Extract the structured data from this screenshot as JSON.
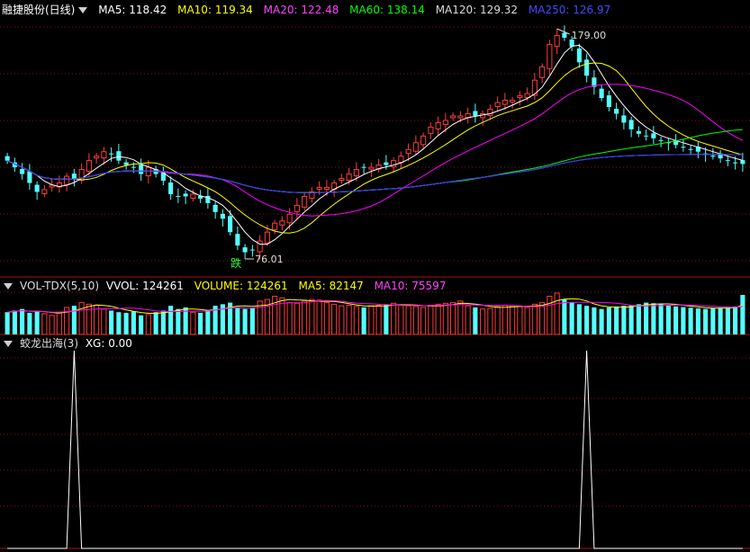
{
  "colors": {
    "bg": "#000000",
    "up": "#ff3c3c",
    "down": "#54ffff",
    "grid": "#8a1010",
    "ma5": "#ffffff",
    "ma10": "#ffff00",
    "ma20": "#ff00ff",
    "ma60": "#00ff00",
    "ma120": "#d0d0d0",
    "ma250": "#3030ff",
    "xg": "#ffffff"
  },
  "price_panel": {
    "stock_name": "融捷股份(日线)",
    "ma": [
      {
        "label": "MA5:",
        "value": "118.42"
      },
      {
        "label": "MA10:",
        "value": "119.34"
      },
      {
        "label": "MA20:",
        "value": "122.48"
      },
      {
        "label": "MA60:",
        "value": "138.14"
      },
      {
        "label": "MA120:",
        "value": "129.32"
      },
      {
        "label": "MA250:",
        "value": "126.97"
      }
    ],
    "high_label": "179.00",
    "low_label": "76.01",
    "signal_tag": "跌"
  },
  "volume_panel": {
    "title": "VOL-TDX(5,10)",
    "items": [
      {
        "label": "VVOL:",
        "value": "124261"
      },
      {
        "label": "VOLUME:",
        "value": "124261"
      },
      {
        "label": "MA5:",
        "value": "82147"
      },
      {
        "label": "MA10:",
        "value": "75597"
      }
    ]
  },
  "xg_panel": {
    "title": "蛟龙出海(3)",
    "items": [
      {
        "label": "XG:",
        "value": "0.00"
      }
    ]
  },
  "chart_data": [
    {
      "type": "candlestick",
      "title": "融捷股份(日线)",
      "ylim": [
        76.01,
        179.0
      ],
      "close": [
        120,
        117,
        114,
        110,
        106,
        107,
        109,
        110,
        113,
        112,
        116,
        120,
        122,
        124,
        123,
        120,
        118,
        117,
        114,
        117,
        114,
        111,
        105,
        104,
        104,
        105,
        103,
        101,
        97,
        94,
        88,
        82,
        79,
        80,
        84,
        88,
        92,
        93,
        96,
        100,
        104,
        106,
        108,
        108,
        110,
        112,
        114,
        116,
        117,
        117,
        118,
        118,
        120,
        122,
        125,
        128,
        131,
        135,
        137,
        138,
        140,
        140,
        141,
        140,
        141,
        143,
        146,
        147,
        147,
        149,
        150,
        156,
        162,
        172,
        176,
        175,
        171,
        164,
        158,
        153,
        148,
        144,
        141,
        137,
        134,
        132,
        131,
        130,
        129,
        128,
        127,
        126,
        125,
        124,
        123,
        122,
        121,
        120,
        119,
        118.5
      ],
      "volume": [
        70,
        75,
        80,
        68,
        72,
        65,
        60,
        70,
        85,
        90,
        100,
        95,
        92,
        80,
        75,
        70,
        68,
        72,
        60,
        62,
        70,
        75,
        90,
        80,
        85,
        70,
        68,
        75,
        90,
        95,
        100,
        85,
        80,
        82,
        105,
        110,
        120,
        115,
        100,
        98,
        105,
        110,
        108,
        100,
        95,
        90,
        92,
        88,
        85,
        90,
        92,
        95,
        98,
        92,
        90,
        88,
        85,
        92,
        95,
        98,
        100,
        105,
        90,
        85,
        80,
        82,
        88,
        92,
        90,
        88,
        85,
        95,
        100,
        120,
        130,
        110,
        100,
        95,
        90,
        85,
        80,
        85,
        88,
        90,
        92,
        95,
        100,
        98,
        95,
        92,
        88,
        86,
        84,
        82,
        80,
        82,
        84,
        86,
        88,
        124.261
      ],
      "volume_unit": "thousand lots"
    },
    {
      "type": "line",
      "name": "XG",
      "spikes_at_index": [
        9,
        78
      ],
      "values_range": [
        0,
        1
      ]
    }
  ]
}
